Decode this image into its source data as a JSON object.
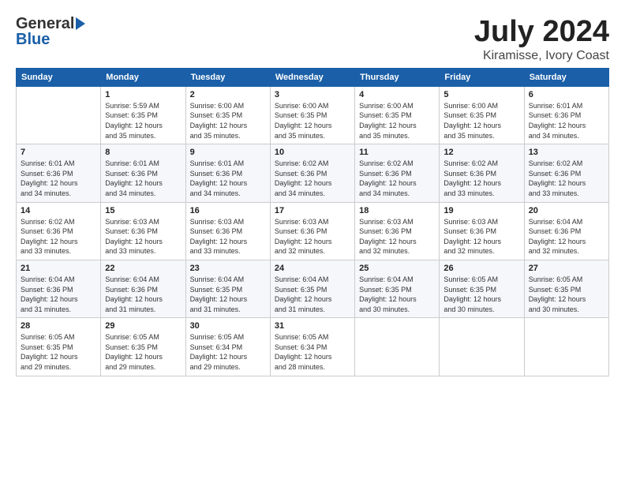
{
  "header": {
    "logo_general": "General",
    "logo_blue": "Blue",
    "title": "July 2024",
    "subtitle": "Kiramisse, Ivory Coast"
  },
  "weekdays": [
    "Sunday",
    "Monday",
    "Tuesday",
    "Wednesday",
    "Thursday",
    "Friday",
    "Saturday"
  ],
  "weeks": [
    [
      {
        "num": "",
        "detail": ""
      },
      {
        "num": "1",
        "detail": "Sunrise: 5:59 AM\nSunset: 6:35 PM\nDaylight: 12 hours\nand 35 minutes."
      },
      {
        "num": "2",
        "detail": "Sunrise: 6:00 AM\nSunset: 6:35 PM\nDaylight: 12 hours\nand 35 minutes."
      },
      {
        "num": "3",
        "detail": "Sunrise: 6:00 AM\nSunset: 6:35 PM\nDaylight: 12 hours\nand 35 minutes."
      },
      {
        "num": "4",
        "detail": "Sunrise: 6:00 AM\nSunset: 6:35 PM\nDaylight: 12 hours\nand 35 minutes."
      },
      {
        "num": "5",
        "detail": "Sunrise: 6:00 AM\nSunset: 6:35 PM\nDaylight: 12 hours\nand 35 minutes."
      },
      {
        "num": "6",
        "detail": "Sunrise: 6:01 AM\nSunset: 6:36 PM\nDaylight: 12 hours\nand 34 minutes."
      }
    ],
    [
      {
        "num": "7",
        "detail": "Sunrise: 6:01 AM\nSunset: 6:36 PM\nDaylight: 12 hours\nand 34 minutes."
      },
      {
        "num": "8",
        "detail": "Sunrise: 6:01 AM\nSunset: 6:36 PM\nDaylight: 12 hours\nand 34 minutes."
      },
      {
        "num": "9",
        "detail": "Sunrise: 6:01 AM\nSunset: 6:36 PM\nDaylight: 12 hours\nand 34 minutes."
      },
      {
        "num": "10",
        "detail": "Sunrise: 6:02 AM\nSunset: 6:36 PM\nDaylight: 12 hours\nand 34 minutes."
      },
      {
        "num": "11",
        "detail": "Sunrise: 6:02 AM\nSunset: 6:36 PM\nDaylight: 12 hours\nand 34 minutes."
      },
      {
        "num": "12",
        "detail": "Sunrise: 6:02 AM\nSunset: 6:36 PM\nDaylight: 12 hours\nand 33 minutes."
      },
      {
        "num": "13",
        "detail": "Sunrise: 6:02 AM\nSunset: 6:36 PM\nDaylight: 12 hours\nand 33 minutes."
      }
    ],
    [
      {
        "num": "14",
        "detail": "Sunrise: 6:02 AM\nSunset: 6:36 PM\nDaylight: 12 hours\nand 33 minutes."
      },
      {
        "num": "15",
        "detail": "Sunrise: 6:03 AM\nSunset: 6:36 PM\nDaylight: 12 hours\nand 33 minutes."
      },
      {
        "num": "16",
        "detail": "Sunrise: 6:03 AM\nSunset: 6:36 PM\nDaylight: 12 hours\nand 33 minutes."
      },
      {
        "num": "17",
        "detail": "Sunrise: 6:03 AM\nSunset: 6:36 PM\nDaylight: 12 hours\nand 32 minutes."
      },
      {
        "num": "18",
        "detail": "Sunrise: 6:03 AM\nSunset: 6:36 PM\nDaylight: 12 hours\nand 32 minutes."
      },
      {
        "num": "19",
        "detail": "Sunrise: 6:03 AM\nSunset: 6:36 PM\nDaylight: 12 hours\nand 32 minutes."
      },
      {
        "num": "20",
        "detail": "Sunrise: 6:04 AM\nSunset: 6:36 PM\nDaylight: 12 hours\nand 32 minutes."
      }
    ],
    [
      {
        "num": "21",
        "detail": "Sunrise: 6:04 AM\nSunset: 6:36 PM\nDaylight: 12 hours\nand 31 minutes."
      },
      {
        "num": "22",
        "detail": "Sunrise: 6:04 AM\nSunset: 6:36 PM\nDaylight: 12 hours\nand 31 minutes."
      },
      {
        "num": "23",
        "detail": "Sunrise: 6:04 AM\nSunset: 6:35 PM\nDaylight: 12 hours\nand 31 minutes."
      },
      {
        "num": "24",
        "detail": "Sunrise: 6:04 AM\nSunset: 6:35 PM\nDaylight: 12 hours\nand 31 minutes."
      },
      {
        "num": "25",
        "detail": "Sunrise: 6:04 AM\nSunset: 6:35 PM\nDaylight: 12 hours\nand 30 minutes."
      },
      {
        "num": "26",
        "detail": "Sunrise: 6:05 AM\nSunset: 6:35 PM\nDaylight: 12 hours\nand 30 minutes."
      },
      {
        "num": "27",
        "detail": "Sunrise: 6:05 AM\nSunset: 6:35 PM\nDaylight: 12 hours\nand 30 minutes."
      }
    ],
    [
      {
        "num": "28",
        "detail": "Sunrise: 6:05 AM\nSunset: 6:35 PM\nDaylight: 12 hours\nand 29 minutes."
      },
      {
        "num": "29",
        "detail": "Sunrise: 6:05 AM\nSunset: 6:35 PM\nDaylight: 12 hours\nand 29 minutes."
      },
      {
        "num": "30",
        "detail": "Sunrise: 6:05 AM\nSunset: 6:34 PM\nDaylight: 12 hours\nand 29 minutes."
      },
      {
        "num": "31",
        "detail": "Sunrise: 6:05 AM\nSunset: 6:34 PM\nDaylight: 12 hours\nand 28 minutes."
      },
      {
        "num": "",
        "detail": ""
      },
      {
        "num": "",
        "detail": ""
      },
      {
        "num": "",
        "detail": ""
      }
    ]
  ]
}
